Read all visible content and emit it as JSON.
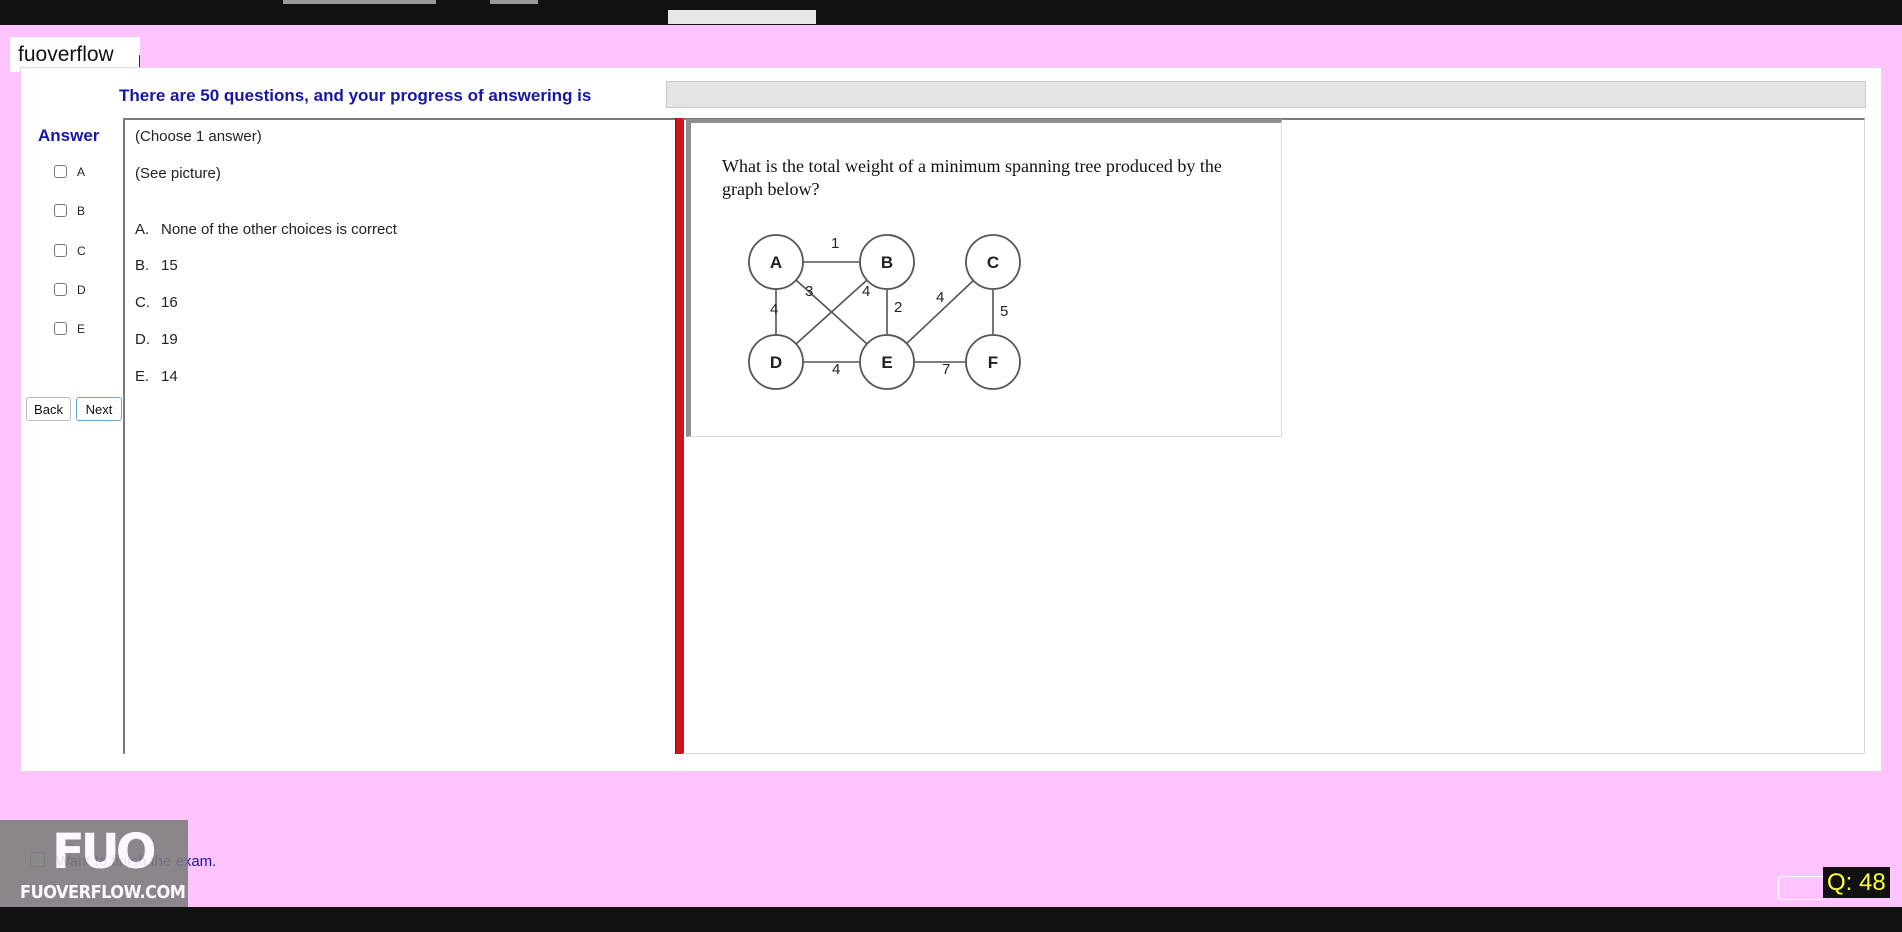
{
  "watermark_top": "fuoverflow",
  "progress": {
    "label": "There are 50 questions, and your progress of answering is",
    "fraction": 0.0
  },
  "answer_panel": {
    "title": "Answer",
    "options": [
      "A",
      "B",
      "C",
      "D",
      "E"
    ]
  },
  "nav": {
    "back": "Back",
    "next": "Next"
  },
  "question_text": {
    "instruction": "(Choose 1 answer)",
    "see_picture": "(See picture)",
    "choices": [
      {
        "letter": "A.",
        "text": "None of the other choices is correct"
      },
      {
        "letter": "B.",
        "text": "15"
      },
      {
        "letter": "C.",
        "text": "16"
      },
      {
        "letter": "D.",
        "text": "19"
      },
      {
        "letter": "E.",
        "text": "14"
      }
    ]
  },
  "question_image": {
    "text": "What is the total weight of a minimum spanning tree produced by the graph below?",
    "graph": {
      "nodes": [
        "A",
        "B",
        "C",
        "D",
        "E",
        "F"
      ],
      "edges": [
        {
          "from": "A",
          "to": "B",
          "weight": "1"
        },
        {
          "from": "A",
          "to": "D",
          "weight": "4"
        },
        {
          "from": "A",
          "to": "E",
          "weight": "3"
        },
        {
          "from": "B",
          "to": "D",
          "weight": "4"
        },
        {
          "from": "B",
          "to": "E",
          "weight": "2"
        },
        {
          "from": "C",
          "to": "E",
          "weight": "4"
        },
        {
          "from": "C",
          "to": "F",
          "weight": "5"
        },
        {
          "from": "D",
          "to": "E",
          "weight": "4"
        },
        {
          "from": "E",
          "to": "F",
          "weight": "7"
        }
      ]
    }
  },
  "finish": {
    "label": "Want to finish the exam."
  },
  "logo": {
    "mark": "FUO",
    "site": "FUOVERFLOW.COM"
  },
  "counter": {
    "label": "Q: 48"
  },
  "colors": {
    "background": "#ffc4ff",
    "accent_blue": "#1616a8",
    "divider_red": "#d0141c",
    "counter_text": "#ffff3a"
  }
}
